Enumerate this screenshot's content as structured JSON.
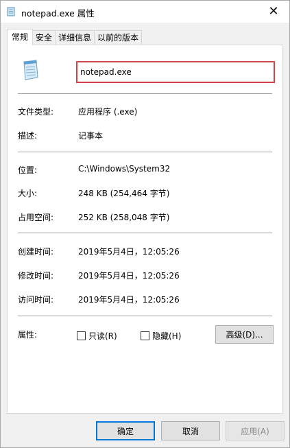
{
  "titlebar": {
    "title": "notepad.exe 属性",
    "close_symbol": "✕"
  },
  "tabs": [
    {
      "label": "常规",
      "active": true
    },
    {
      "label": "安全"
    },
    {
      "label": "详细信息"
    },
    {
      "label": "以前的版本"
    }
  ],
  "general": {
    "file_name": "notepad.exe",
    "file_type_label": "文件类型:",
    "file_type_value": "应用程序 (.exe)",
    "description_label": "描述:",
    "description_value": "记事本",
    "location_label": "位置:",
    "location_value": "C:\\Windows\\System32",
    "size_label": "大小:",
    "size_value": "248 KB (254,464 字节)",
    "size_on_disk_label": "占用空间:",
    "size_on_disk_value": "252 KB (258,048 字节)",
    "created_label": "创建时间:",
    "created_value": "2019年5月4日，12:05:26",
    "modified_label": "修改时间:",
    "modified_value": "2019年5月4日，12:05:26",
    "accessed_label": "访问时间:",
    "accessed_value": "2019年5月4日，12:05:26",
    "attributes_label": "属性:",
    "readonly_label": "只读(R)",
    "hidden_label": "隐藏(H)",
    "advanced_label": "高级(D)..."
  },
  "footer": {
    "ok_label": "确定",
    "cancel_label": "取消",
    "apply_label": "应用(A)"
  },
  "colors": {
    "highlight_border": "#d0454c",
    "default_button_border": "#0078d7"
  },
  "icons": {
    "title": "notepad-icon",
    "file": "notepad-icon"
  }
}
